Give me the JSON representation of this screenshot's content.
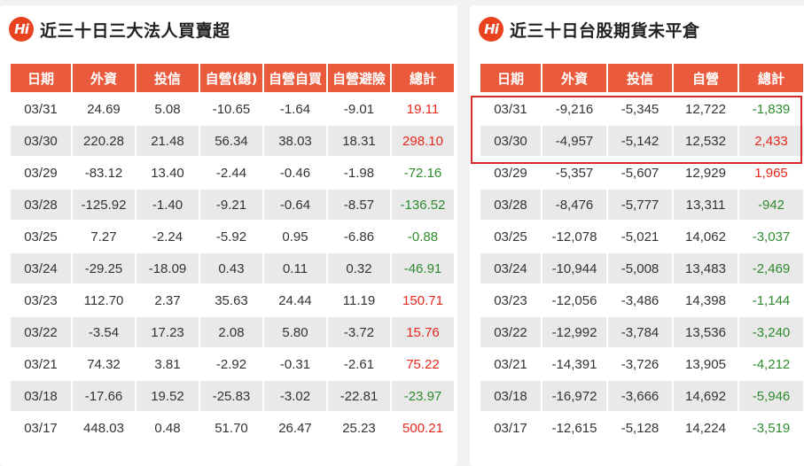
{
  "left_panel": {
    "logo_text": "Hi",
    "title": "近三十日三大法人買賣超",
    "headers": [
      "日期",
      "外資",
      "投信",
      "自營(總)",
      "自營自買",
      "自營避險",
      "總計"
    ],
    "rows": [
      [
        "03/31",
        "24.69",
        "5.08",
        "-10.65",
        "-1.64",
        "-9.01",
        "19.11"
      ],
      [
        "03/30",
        "220.28",
        "21.48",
        "56.34",
        "38.03",
        "18.31",
        "298.10"
      ],
      [
        "03/29",
        "-83.12",
        "13.40",
        "-2.44",
        "-0.46",
        "-1.98",
        "-72.16"
      ],
      [
        "03/28",
        "-125.92",
        "-1.40",
        "-9.21",
        "-0.64",
        "-8.57",
        "-136.52"
      ],
      [
        "03/25",
        "7.27",
        "-2.24",
        "-5.92",
        "0.95",
        "-6.86",
        "-0.88"
      ],
      [
        "03/24",
        "-29.25",
        "-18.09",
        "0.43",
        "0.11",
        "0.32",
        "-46.91"
      ],
      [
        "03/23",
        "112.70",
        "2.37",
        "35.63",
        "24.44",
        "11.19",
        "150.71"
      ],
      [
        "03/22",
        "-3.54",
        "17.23",
        "2.08",
        "5.80",
        "-3.72",
        "15.76"
      ],
      [
        "03/21",
        "74.32",
        "3.81",
        "-2.92",
        "-0.31",
        "-2.61",
        "75.22"
      ],
      [
        "03/18",
        "-17.66",
        "19.52",
        "-25.83",
        "-3.02",
        "-22.81",
        "-23.97"
      ],
      [
        "03/17",
        "448.03",
        "0.48",
        "51.70",
        "26.47",
        "25.23",
        "500.21"
      ]
    ]
  },
  "right_panel": {
    "logo_text": "Hi",
    "title": "近三十日台股期貨未平倉",
    "headers": [
      "日期",
      "外資",
      "投信",
      "自營",
      "總計"
    ],
    "rows": [
      [
        "03/31",
        "-9,216",
        "-5,345",
        "12,722",
        "-1,839"
      ],
      [
        "03/30",
        "-4,957",
        "-5,142",
        "12,532",
        "2,433"
      ],
      [
        "03/29",
        "-5,357",
        "-5,607",
        "12,929",
        "1,965"
      ],
      [
        "03/28",
        "-8,476",
        "-5,777",
        "13,311",
        "-942"
      ],
      [
        "03/25",
        "-12,078",
        "-5,021",
        "14,062",
        "-3,037"
      ],
      [
        "03/24",
        "-10,944",
        "-5,008",
        "13,483",
        "-2,469"
      ],
      [
        "03/23",
        "-12,056",
        "-3,486",
        "14,398",
        "-1,144"
      ],
      [
        "03/22",
        "-12,992",
        "-3,784",
        "13,536",
        "-3,240"
      ],
      [
        "03/21",
        "-14,391",
        "-3,726",
        "13,905",
        "-4,212"
      ],
      [
        "03/18",
        "-16,972",
        "-3,666",
        "14,692",
        "-5,946"
      ],
      [
        "03/17",
        "-12,615",
        "-5,128",
        "14,224",
        "-3,519"
      ]
    ]
  },
  "colors": {
    "header_bg": "#ea5b3d",
    "positive": "#e8271d",
    "negative": "#2f8a2f",
    "highlight_border": "#d62b2b"
  }
}
